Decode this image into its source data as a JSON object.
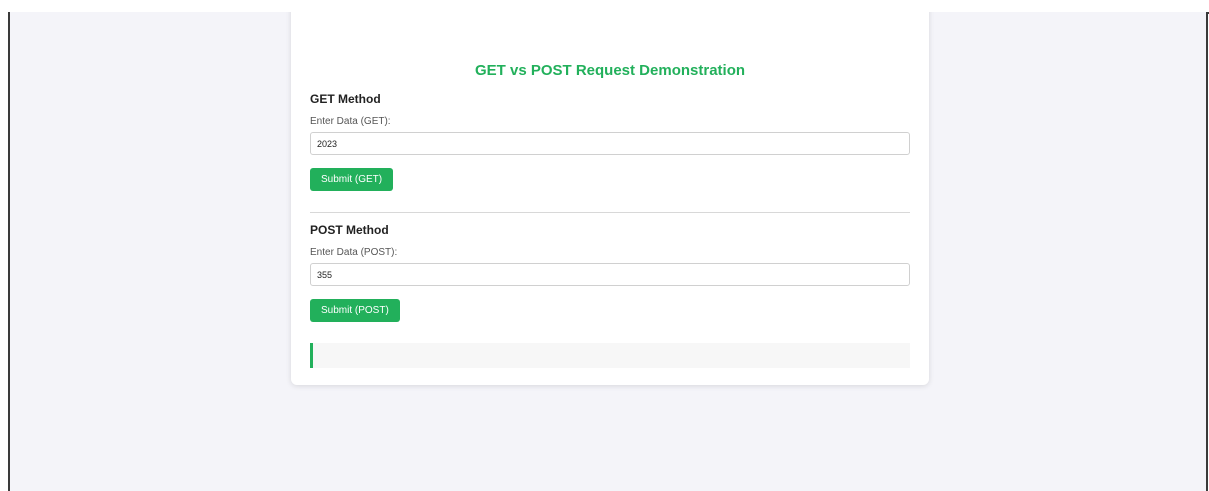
{
  "page": {
    "title": "GET vs POST Request Demonstration"
  },
  "get_section": {
    "heading": "GET Method",
    "field_label": "Enter Data (GET):",
    "field_value": "2023",
    "submit_label": "Submit (GET)"
  },
  "post_section": {
    "heading": "POST Method",
    "field_label": "Enter Data (POST):",
    "field_value": "355",
    "submit_label": "Submit (POST)"
  },
  "result": {
    "text": ""
  },
  "colors": {
    "accent": "#22b05b",
    "page_background": "#f4f4f9",
    "card_background": "#ffffff"
  }
}
